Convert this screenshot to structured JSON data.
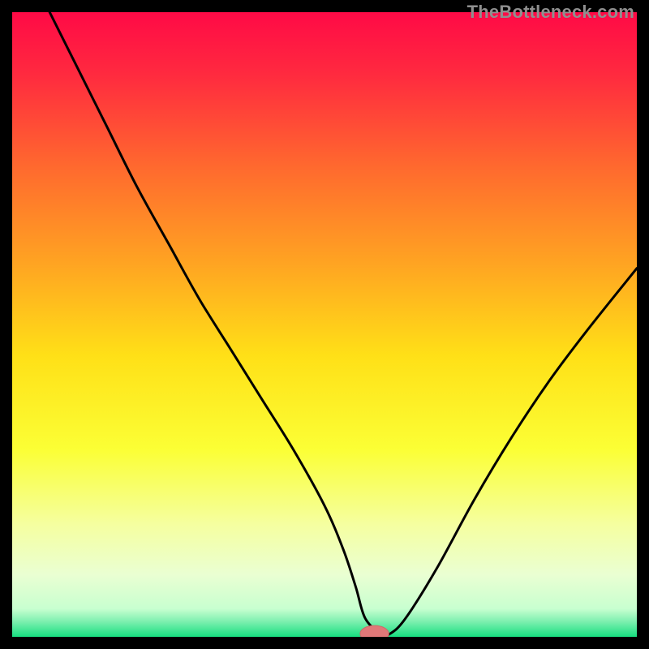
{
  "watermark": "TheBottleneck.com",
  "colors": {
    "background": "#000000",
    "curve": "#000000",
    "marker_fill": "#e07878",
    "marker_stroke": "#d06868"
  },
  "chart_data": {
    "type": "line",
    "title": "",
    "xlabel": "",
    "ylabel": "",
    "xlim": [
      0,
      100
    ],
    "ylim": [
      0,
      100
    ],
    "gradient_stops": [
      {
        "offset": 0.0,
        "color": "#ff0a46"
      },
      {
        "offset": 0.1,
        "color": "#ff2a3f"
      },
      {
        "offset": 0.25,
        "color": "#ff6a2e"
      },
      {
        "offset": 0.4,
        "color": "#ffa322"
      },
      {
        "offset": 0.55,
        "color": "#ffe017"
      },
      {
        "offset": 0.7,
        "color": "#fbff35"
      },
      {
        "offset": 0.82,
        "color": "#f5ffa0"
      },
      {
        "offset": 0.9,
        "color": "#eaffd2"
      },
      {
        "offset": 0.955,
        "color": "#c8ffd0"
      },
      {
        "offset": 0.975,
        "color": "#7ff0b0"
      },
      {
        "offset": 1.0,
        "color": "#17df80"
      }
    ],
    "series": [
      {
        "name": "bottleneck-curve",
        "x": [
          6,
          10,
          15,
          20,
          25,
          30,
          35,
          40,
          45,
          50,
          53,
          55,
          56.5,
          59,
          60.5,
          63,
          68,
          74,
          80,
          86,
          92,
          100
        ],
        "y": [
          100,
          92,
          82,
          72,
          63,
          54,
          46,
          38,
          30,
          21,
          14,
          8,
          3,
          0.5,
          0.5,
          3,
          11,
          22,
          32,
          41,
          49,
          59
        ]
      }
    ],
    "marker": {
      "x": 58,
      "y": 0.5,
      "rx": 2.3,
      "ry": 1.3
    }
  }
}
